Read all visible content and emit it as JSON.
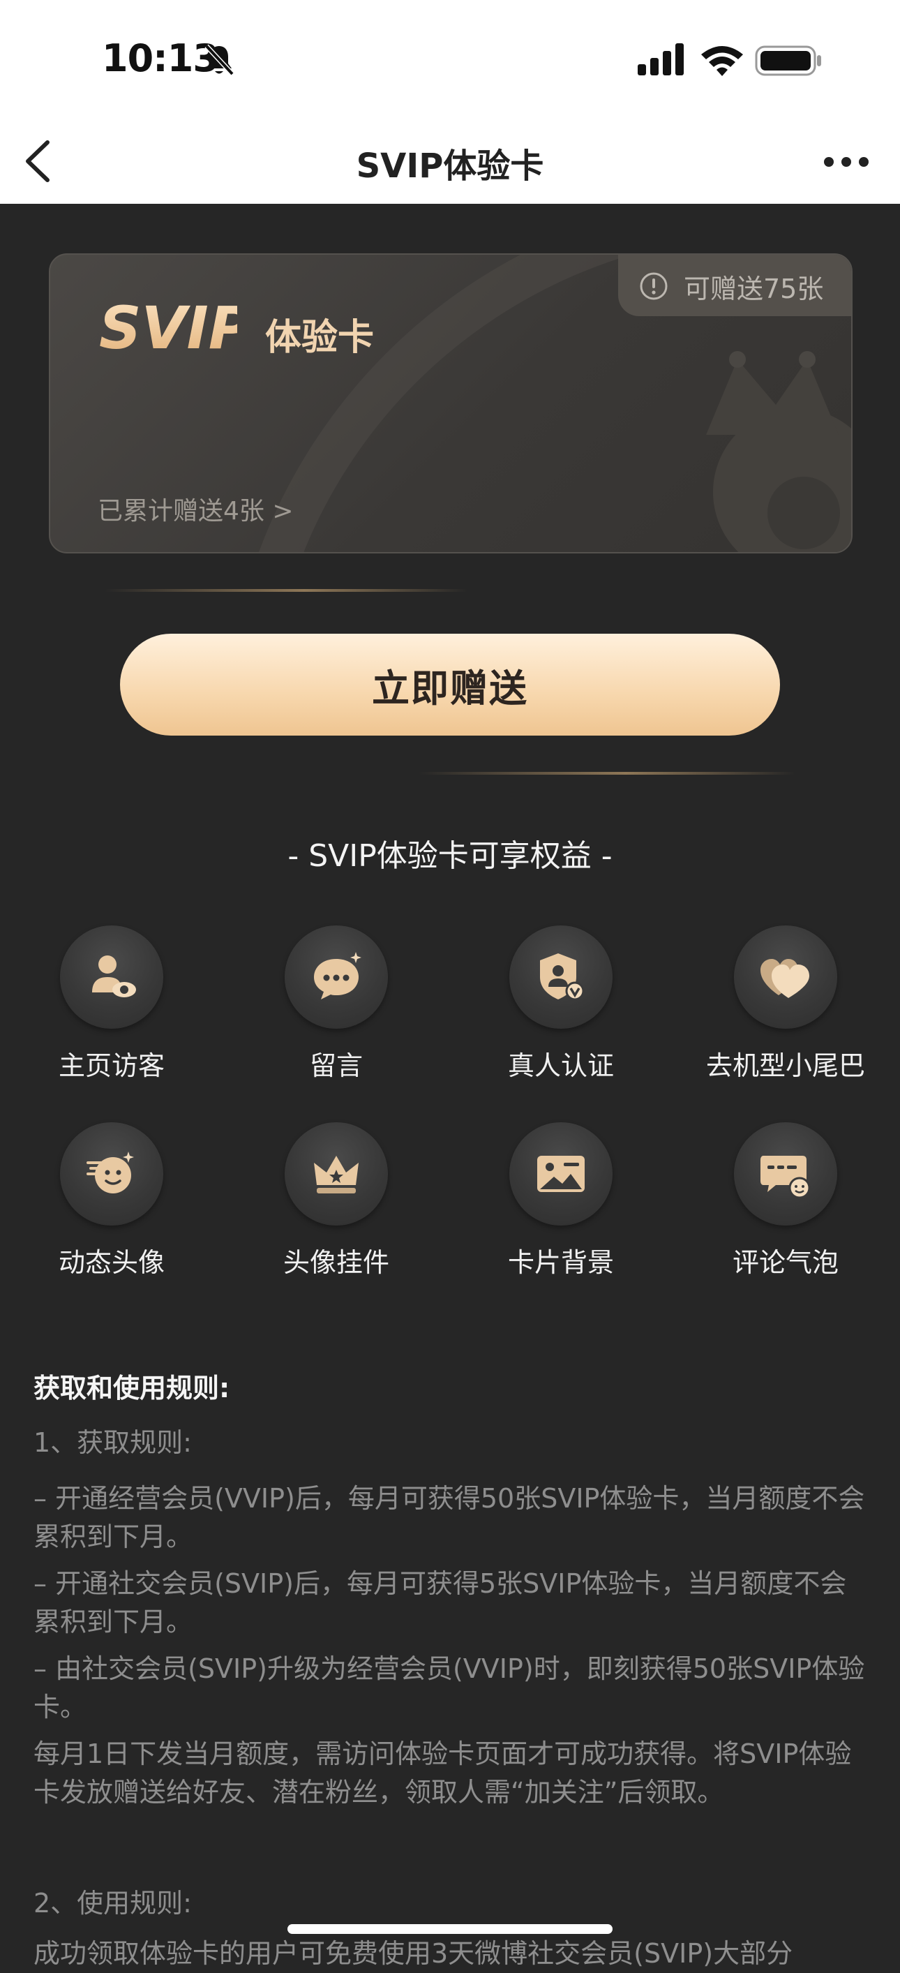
{
  "status_bar": {
    "time": "10:13"
  },
  "nav": {
    "title": "SVIP体验卡"
  },
  "card": {
    "logo_text": "SVIP",
    "title": "体验卡",
    "badge": "可赠送75张",
    "sent_link": "已累计赠送4张 >"
  },
  "send_button": "立即赠送",
  "benefits": {
    "title": "- SVIP体验卡可享权益 -",
    "items": [
      {
        "label": "主页访客",
        "icon": "visitor-icon"
      },
      {
        "label": "留言",
        "icon": "message-icon"
      },
      {
        "label": "真人认证",
        "icon": "verify-icon"
      },
      {
        "label": "去机型小尾巴",
        "icon": "heart-icon"
      },
      {
        "label": "动态头像",
        "icon": "dynamic-avatar-icon"
      },
      {
        "label": "头像挂件",
        "icon": "crown-icon"
      },
      {
        "label": "卡片背景",
        "icon": "picture-icon"
      },
      {
        "label": "评论气泡",
        "icon": "comment-bubble-icon"
      }
    ]
  },
  "rules": {
    "title": "获取和使用规则:",
    "lines": [
      "1、获取规则:",
      "– 开通经营会员(VVIP)后，每月可获得50张SVIP体验卡，当月额度不会累积到下月。",
      "– 开通社交会员(SVIP)后，每月可获得5张SVIP体验卡，当月额度不会累积到下月。",
      "– 由社交会员(SVIP)升级为经营会员(VVIP)时，即刻获得50张SVIP体验卡。",
      "每月1日下发当月额度，需访问体验卡页面才可成功获得。将SVIP体验卡发放赠送给好友、潜在粉丝，领取人需“加关注”后领取。",
      "2、使用规则:",
      "成功领取体验卡的用户可免费使用3天微博社交会员(SVIP)大部分"
    ]
  },
  "colors": {
    "background": "#262626",
    "accent_gold": "#f1d4b0",
    "button_gradient": [
      "#fff0dc",
      "#efc591"
    ]
  }
}
